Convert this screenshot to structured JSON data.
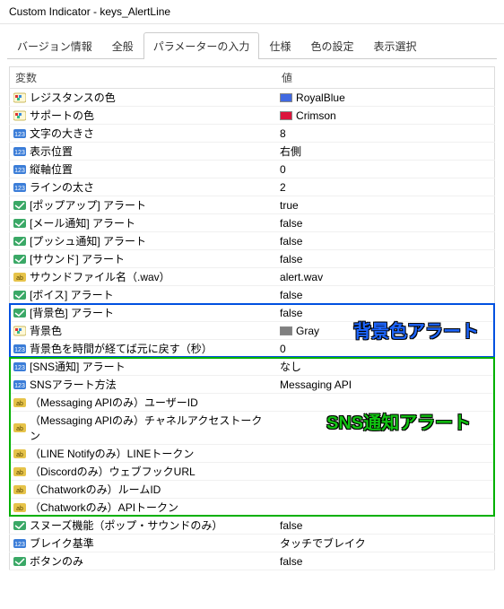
{
  "window": {
    "title": "Custom Indicator - keys_AlertLine"
  },
  "tabs": {
    "items": [
      {
        "label": "バージョン情報"
      },
      {
        "label": "全般"
      },
      {
        "label": "パラメーターの入力",
        "active": true
      },
      {
        "label": "仕様"
      },
      {
        "label": "色の設定"
      },
      {
        "label": "表示選択"
      }
    ]
  },
  "columns": {
    "var": "変数",
    "val": "値"
  },
  "rows": [
    {
      "icon": "color",
      "name": "レジスタンスの色",
      "value_text": "RoyalBlue",
      "swatch": "#4169e1"
    },
    {
      "icon": "color",
      "name": "サポートの色",
      "value_text": "Crimson",
      "swatch": "#dc143c"
    },
    {
      "icon": "int",
      "name": "文字の大きさ",
      "value_text": "8"
    },
    {
      "icon": "int",
      "name": "表示位置",
      "value_text": "右側"
    },
    {
      "icon": "int",
      "name": "縦軸位置",
      "value_text": "0"
    },
    {
      "icon": "int",
      "name": "ラインの太さ",
      "value_text": "2"
    },
    {
      "icon": "bool",
      "name": "[ポップアップ] アラート",
      "value_text": "true"
    },
    {
      "icon": "bool",
      "name": "[メール通知] アラート",
      "value_text": "false"
    },
    {
      "icon": "bool",
      "name": "[プッシュ通知] アラート",
      "value_text": "false"
    },
    {
      "icon": "bool",
      "name": "[サウンド] アラート",
      "value_text": "false"
    },
    {
      "icon": "string",
      "name": "サウンドファイル名（.wav）",
      "value_text": "alert.wav"
    },
    {
      "icon": "bool",
      "name": "[ボイス] アラート",
      "value_text": "false"
    },
    {
      "icon": "bool",
      "name": "[背景色] アラート",
      "value_text": "false"
    },
    {
      "icon": "color",
      "name": "背景色",
      "value_text": "Gray",
      "swatch": "#808080"
    },
    {
      "icon": "int",
      "name": "背景色を時間が経てば元に戻す（秒）",
      "value_text": "0"
    },
    {
      "icon": "int",
      "name": "[SNS通知] アラート",
      "value_text": "なし"
    },
    {
      "icon": "int",
      "name": "SNSアラート方法",
      "value_text": "Messaging API"
    },
    {
      "icon": "string",
      "name": "（Messaging APIのみ）ユーザーID",
      "value_text": ""
    },
    {
      "icon": "string",
      "name": "（Messaging APIのみ）チャネルアクセストークン",
      "value_text": ""
    },
    {
      "icon": "string",
      "name": "（LINE Notifyのみ）LINEトークン",
      "value_text": ""
    },
    {
      "icon": "string",
      "name": "（Discordのみ）ウェブフックURL",
      "value_text": ""
    },
    {
      "icon": "string",
      "name": "（Chatworkのみ）ルームID",
      "value_text": ""
    },
    {
      "icon": "string",
      "name": "（Chatworkのみ）APIトークン",
      "value_text": ""
    },
    {
      "icon": "bool",
      "name": "スヌーズ機能（ポップ・サウンドのみ）",
      "value_text": "false"
    },
    {
      "icon": "int",
      "name": "ブレイク基準",
      "value_text": "タッチでブレイク"
    },
    {
      "icon": "bool",
      "name": "ボタンのみ",
      "value_text": "false"
    }
  ],
  "annotations": {
    "blue_label": "背景色アラート",
    "green_label": "SNS通知アラート"
  }
}
